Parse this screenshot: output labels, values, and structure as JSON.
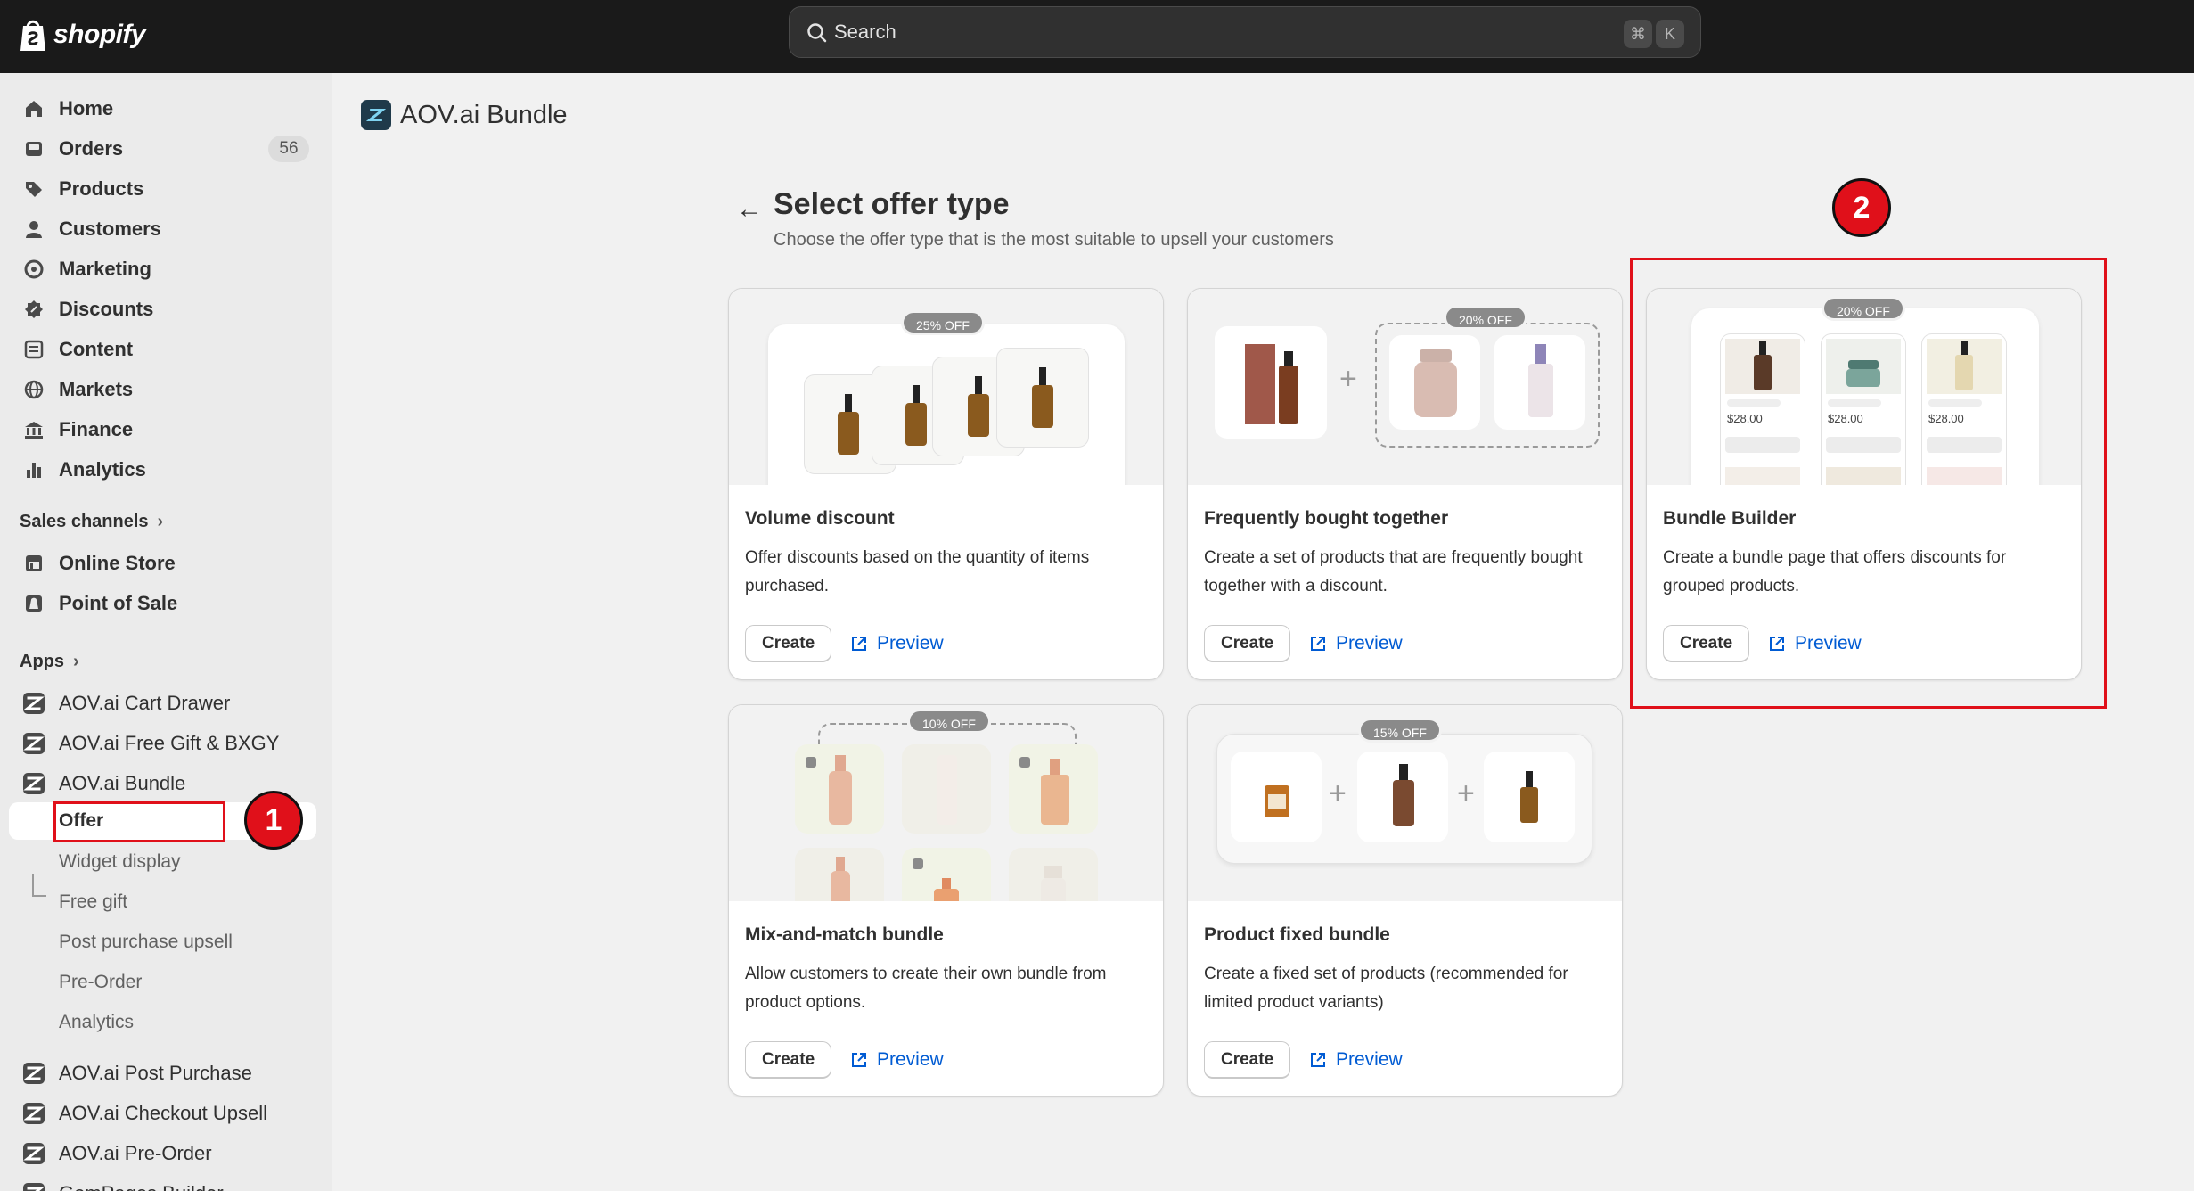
{
  "topbar": {
    "logo_text": "shopify",
    "search_placeholder": "Search",
    "shortcut_cmd": "⌘",
    "shortcut_key": "K"
  },
  "sidebar": {
    "nav": [
      {
        "label": "Home",
        "icon": "home-icon"
      },
      {
        "label": "Orders",
        "icon": "orders-icon",
        "count": "56"
      },
      {
        "label": "Products",
        "icon": "tag-icon"
      },
      {
        "label": "Customers",
        "icon": "person-icon"
      },
      {
        "label": "Marketing",
        "icon": "target-icon"
      },
      {
        "label": "Discounts",
        "icon": "discount-icon"
      },
      {
        "label": "Content",
        "icon": "content-icon"
      },
      {
        "label": "Markets",
        "icon": "globe-icon"
      },
      {
        "label": "Finance",
        "icon": "bank-icon"
      },
      {
        "label": "Analytics",
        "icon": "bar-chart-icon"
      }
    ],
    "sales_channels_heading": "Sales channels",
    "sales_channels": [
      {
        "label": "Online Store",
        "icon": "store-icon"
      },
      {
        "label": "Point of Sale",
        "icon": "pos-icon"
      }
    ],
    "apps_heading": "Apps",
    "apps": [
      {
        "label": "AOV.ai Cart Drawer"
      },
      {
        "label": "AOV.ai Free Gift & BXGY"
      },
      {
        "label": "AOV.ai Bundle"
      }
    ],
    "bundle_subitems": [
      {
        "label": "Offer",
        "active": true
      },
      {
        "label": "Widget display"
      },
      {
        "label": "Free gift"
      },
      {
        "label": "Post purchase upsell"
      },
      {
        "label": "Pre-Order"
      },
      {
        "label": "Analytics"
      }
    ],
    "more_apps": [
      {
        "label": "AOV.ai Post Purchase"
      },
      {
        "label": "AOV.ai Checkout Upsell"
      },
      {
        "label": "AOV.ai Pre-Order"
      },
      {
        "label": "GemPages Builder"
      }
    ]
  },
  "main": {
    "app_title": "AOV.ai Bundle",
    "page_title": "Select offer type",
    "page_subtitle": "Choose the offer type that is the most suitable to upsell your customers",
    "create_label": "Create",
    "preview_label": "Preview",
    "cards": [
      {
        "title": "Volume discount",
        "description": "Offer discounts based on the quantity of items purchased.",
        "badge": "25% OFF"
      },
      {
        "title": "Frequently bought together",
        "description": "Create a set of products that are frequently bought together with a discount.",
        "badge": "20% OFF"
      },
      {
        "title": "Bundle Builder",
        "description": "Create a bundle page that offers discounts for grouped products.",
        "badge": "20% OFF",
        "prices": [
          "$28.00",
          "$28.00",
          "$28.00"
        ]
      },
      {
        "title": "Mix-and-match bundle",
        "description": "Allow customers to create their own bundle from product options.",
        "badge": "10% OFF"
      },
      {
        "title": "Product fixed bundle",
        "description": "Create a fixed set of products (recommended for limited product variants)",
        "badge": "15% OFF"
      }
    ]
  },
  "annotations": {
    "step_1": "1",
    "step_2": "2",
    "color": "#e0101a"
  },
  "colors": {
    "topbar": "#1a1a1a",
    "link": "#005bd3",
    "sidebar_bg": "#ebebeb",
    "page_bg": "#f1f1f1"
  }
}
